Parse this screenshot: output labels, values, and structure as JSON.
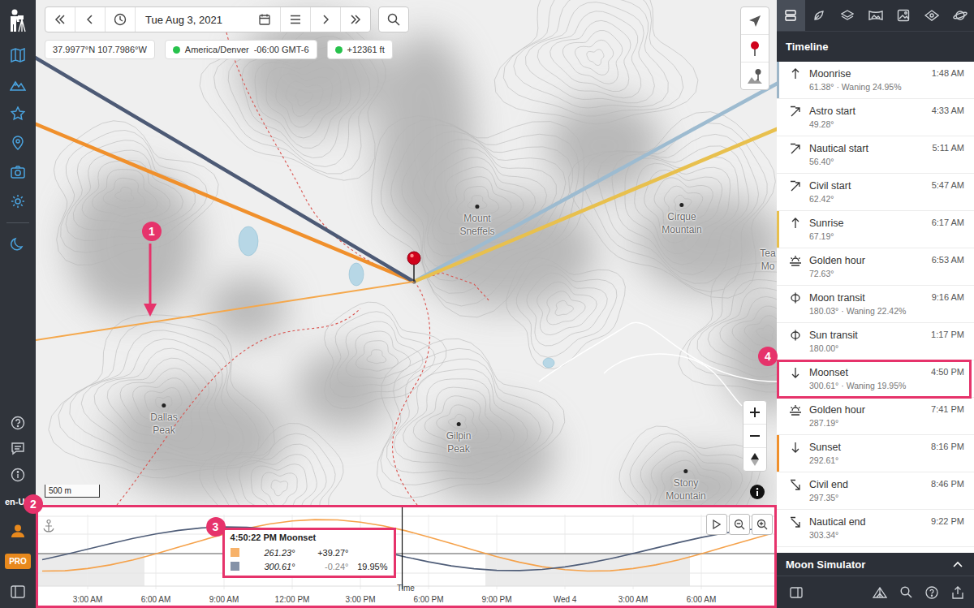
{
  "app": {
    "language": "en-U",
    "badge": "PRO"
  },
  "toolbar": {
    "date": "Tue Aug 3, 2021"
  },
  "location": {
    "coordinates": "37.9977°N 107.7986°W",
    "timezone": "America/Denver",
    "offset": "-06:00 GMT-6",
    "timezone_ok": true,
    "elevation": "+12361 ft",
    "elevation_ok": true
  },
  "map": {
    "scale": "500 m",
    "labels": [
      {
        "name": "Mount Sneffels",
        "dot_visible": true
      },
      {
        "name": "Cirque Mountain",
        "dot_visible": true
      },
      {
        "name": "Dallas Peak",
        "dot_visible": true
      },
      {
        "name": "Gilpin Peak",
        "dot_visible": true
      },
      {
        "name": "Stony Mountain",
        "dot_visible": true
      },
      {
        "name": "Tea Mo",
        "dot_visible": false
      }
    ],
    "azimuth_lines": [
      {
        "name": "Moonrise",
        "azimuth": 61.38,
        "color": "#9dbbd0",
        "kind": "event"
      },
      {
        "name": "Sunrise",
        "azimuth": 67.19,
        "color": "#e8c04e",
        "kind": "event"
      },
      {
        "name": "Sunset",
        "azimuth": 292.61,
        "color": "#f0902c",
        "kind": "event"
      },
      {
        "name": "Moonset",
        "azimuth": 300.61,
        "color": "#4d5a75",
        "kind": "event"
      },
      {
        "name": "Sun now",
        "azimuth": 261.23,
        "color": "#f5a84c",
        "kind": "current"
      }
    ]
  },
  "annotations": [
    {
      "label": "1",
      "target": "map"
    },
    {
      "label": "2",
      "target": "chart"
    },
    {
      "label": "3",
      "target": "tooltip"
    },
    {
      "label": "4",
      "target": "timeline",
      "event_index": 8
    }
  ],
  "chart": {
    "axis_title": "Time",
    "start_hour": 1,
    "cursor_hour": 16.84,
    "ticks": [
      {
        "label": "3:00 AM",
        "hour": 3
      },
      {
        "label": "6:00 AM",
        "hour": 6
      },
      {
        "label": "9:00 AM",
        "hour": 9
      },
      {
        "label": "12:00 PM",
        "hour": 12
      },
      {
        "label": "3:00 PM",
        "hour": 15
      },
      {
        "label": "6:00 PM",
        "hour": 18
      },
      {
        "label": "9:00 PM",
        "hour": 21
      },
      {
        "label": "Wed 4",
        "hour": 24
      },
      {
        "label": "3:00 AM",
        "hour": 27
      },
      {
        "label": "6:00 AM",
        "hour": 30
      }
    ],
    "series": [
      {
        "name": "Sun",
        "color": "#f5a24b",
        "values": [
          -35.8,
          -35.1,
          -30.7,
          -23.1,
          -12.8,
          -0.4,
          13.1,
          26.9,
          40.1,
          51.6,
          60.8,
          67.0,
          69.8,
          69.1,
          64.7,
          57.1,
          46.8,
          34.4,
          20.9,
          7.1,
          -6.1,
          -17.6,
          -26.8,
          -33.0,
          -35.8,
          -35.1,
          -30.7,
          -23.1,
          -12.8,
          -0.4,
          13.1,
          26.9,
          40.1
        ]
      },
      {
        "name": "Moon",
        "color": "#4f5d78",
        "values": [
          -12.5,
          -2.1,
          9.2,
          20.5,
          31.1,
          40.4,
          47.7,
          52.7,
          54.9,
          54.2,
          50.8,
          44.7,
          36.4,
          26.3,
          15.3,
          4.0,
          -7.0,
          -16.9,
          -25.1,
          -31.0,
          -34.4,
          -34.8,
          -32.5,
          -27.4,
          -19.9,
          -10.5,
          0.2,
          11.5,
          22.7,
          33.1,
          42.0,
          48.9,
          53.5
        ]
      }
    ],
    "tooltip": {
      "title": "4:50:22 PM Moonset",
      "rows": [
        {
          "color": "#f7b26a",
          "azimuth": "261.23°",
          "altitude": "+39.27°",
          "below_horizon": false,
          "phase": ""
        },
        {
          "color": "#8592a8",
          "azimuth": "300.61°",
          "altitude": "-0.24°",
          "below_horizon": true,
          "phase": "19.95%"
        }
      ]
    }
  },
  "panel": {
    "tabs": [
      {
        "selected": true
      },
      {
        "selected": false
      },
      {
        "selected": false
      },
      {
        "selected": false
      },
      {
        "selected": false
      },
      {
        "selected": false
      },
      {
        "selected": false
      }
    ],
    "title": "Timeline",
    "events": [
      {
        "kind": "rise",
        "name": "Moonrise",
        "detail": "61.38° · Waning 24.95%",
        "time": "1:48 AM",
        "color": "#9db6c8"
      },
      {
        "kind": "twilight_start",
        "name": "Astro start",
        "detail": "49.28°",
        "time": "4:33 AM",
        "color": null
      },
      {
        "kind": "twilight_start",
        "name": "Nautical start",
        "detail": "56.40°",
        "time": "5:11 AM",
        "color": null
      },
      {
        "kind": "twilight_start",
        "name": "Civil start",
        "detail": "62.42°",
        "time": "5:47 AM",
        "color": null
      },
      {
        "kind": "rise",
        "name": "Sunrise",
        "detail": "67.19°",
        "time": "6:17 AM",
        "color": "#e8c04e"
      },
      {
        "kind": "golden",
        "name": "Golden hour",
        "detail": "72.63°",
        "time": "6:53 AM",
        "color": null
      },
      {
        "kind": "transit",
        "name": "Moon transit",
        "detail": "180.03° · Waning 22.42%",
        "time": "9:16 AM",
        "color": null
      },
      {
        "kind": "transit",
        "name": "Sun transit",
        "detail": "180.00°",
        "time": "1:17 PM",
        "color": null
      },
      {
        "kind": "set",
        "name": "Moonset",
        "detail": "300.61° · Waning 19.95%",
        "time": "4:50 PM",
        "color": "#2c3550"
      },
      {
        "kind": "golden",
        "name": "Golden hour",
        "detail": "287.19°",
        "time": "7:41 PM",
        "color": null
      },
      {
        "kind": "set",
        "name": "Sunset",
        "detail": "292.61°",
        "time": "8:16 PM",
        "color": "#f0902c"
      },
      {
        "kind": "twilight_end",
        "name": "Civil end",
        "detail": "297.35°",
        "time": "8:46 PM",
        "color": null
      },
      {
        "kind": "twilight_end",
        "name": "Nautical end",
        "detail": "303.34°",
        "time": "9:22 PM",
        "color": null
      }
    ],
    "simulator": {
      "title": "Moon Simulator",
      "expanded": false
    }
  }
}
